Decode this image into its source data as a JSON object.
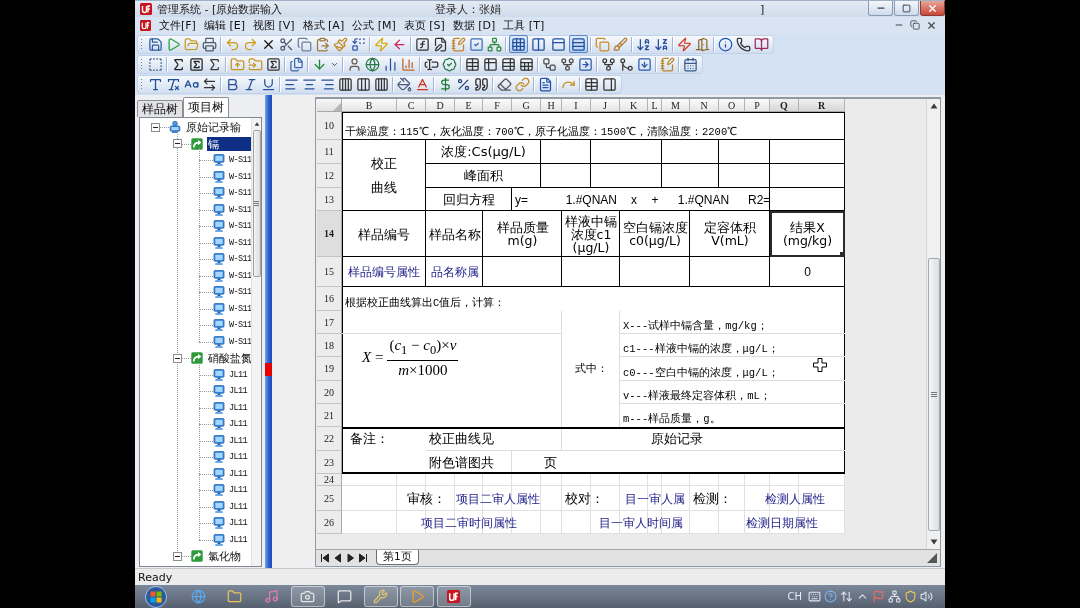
{
  "window": {
    "title": "管理系统 - [原始数据输入",
    "user": "登录人：张娟",
    "title_end": "]"
  },
  "menu": [
    "文件[F]",
    "编辑 [E]",
    "视图 [V]",
    "格式 [A]",
    "公式 [M]",
    "表页 [S]",
    "数据 [D]",
    "工具 [T]"
  ],
  "toolbar": {
    "view_toggles": [
      {
        "pressed": true
      },
      {
        "pressed": false
      },
      {
        "pressed": false
      },
      {
        "pressed": true
      }
    ]
  },
  "side_tabs": [
    {
      "label": "样品树",
      "selected": false
    },
    {
      "label": "项目树",
      "selected": true
    }
  ],
  "tree": [
    {
      "label": "原始记录输",
      "kind": "root",
      "expanded": true,
      "selected": false,
      "children": [
        {
          "label": "镉",
          "kind": "group",
          "expanded": true,
          "selected": true,
          "children": [
            {
              "label": "W-S11",
              "kind": "leaf",
              "selected": false
            },
            {
              "label": "W-S11",
              "kind": "leaf",
              "selected": false
            },
            {
              "label": "W-S11",
              "kind": "leaf",
              "selected": false
            },
            {
              "label": "W-S11",
              "kind": "leaf",
              "selected": false
            },
            {
              "label": "W-S11",
              "kind": "leaf",
              "selected": false
            },
            {
              "label": "W-S11",
              "kind": "leaf",
              "selected": false
            },
            {
              "label": "W-S11",
              "kind": "leaf",
              "selected": false
            },
            {
              "label": "W-S11",
              "kind": "leaf",
              "selected": false
            },
            {
              "label": "W-S11",
              "kind": "leaf",
              "selected": false
            },
            {
              "label": "W-S11",
              "kind": "leaf",
              "selected": false
            },
            {
              "label": "W-S11",
              "kind": "leaf",
              "selected": false
            },
            {
              "label": "W-S11",
              "kind": "leaf",
              "selected": false
            }
          ]
        },
        {
          "label": "硝酸盐氮",
          "kind": "group",
          "expanded": true,
          "selected": false,
          "children": [
            {
              "label": "JL11",
              "kind": "leaf",
              "selected": false
            },
            {
              "label": "JL11",
              "kind": "leaf",
              "selected": false
            },
            {
              "label": "JL11",
              "kind": "leaf",
              "selected": false
            },
            {
              "label": "JL11",
              "kind": "leaf",
              "selected": false
            },
            {
              "label": "JL11",
              "kind": "leaf",
              "selected": false
            },
            {
              "label": "JL11",
              "kind": "leaf",
              "selected": false
            },
            {
              "label": "JL11",
              "kind": "leaf",
              "selected": false
            },
            {
              "label": "JL11",
              "kind": "leaf",
              "selected": false
            },
            {
              "label": "JL11",
              "kind": "leaf",
              "selected": false
            },
            {
              "label": "JL11",
              "kind": "leaf",
              "selected": false
            },
            {
              "label": "JL11",
              "kind": "leaf",
              "selected": false
            }
          ]
        },
        {
          "label": "氯化物",
          "kind": "group",
          "expanded": true,
          "selected": false
        }
      ]
    }
  ],
  "sheet": {
    "column_headers": [
      {
        "label": "B",
        "selected": false
      },
      {
        "label": "C",
        "selected": false
      },
      {
        "label": "D",
        "selected": false
      },
      {
        "label": "E",
        "selected": false
      },
      {
        "label": "F",
        "selected": false
      },
      {
        "label": "G",
        "selected": false
      },
      {
        "label": "H",
        "selected": false
      },
      {
        "label": "I",
        "selected": false
      },
      {
        "label": "J",
        "selected": false
      },
      {
        "label": "K",
        "selected": false
      },
      {
        "label": "L",
        "selected": false
      },
      {
        "label": "M",
        "selected": false
      },
      {
        "label": "N",
        "selected": false
      },
      {
        "label": "O",
        "selected": false
      },
      {
        "label": "P",
        "selected": false
      },
      {
        "label": "Q",
        "selected": true
      },
      {
        "label": "R",
        "selected": true
      }
    ],
    "row_headers": [
      {
        "label": "10",
        "selected": false
      },
      {
        "label": "11",
        "selected": false
      },
      {
        "label": "12",
        "selected": false
      },
      {
        "label": "13",
        "selected": false
      },
      {
        "label": "14",
        "selected": true
      },
      {
        "label": "15",
        "selected": false
      },
      {
        "label": "16",
        "selected": false
      },
      {
        "label": "17",
        "selected": false
      },
      {
        "label": "18",
        "selected": false
      },
      {
        "label": "19",
        "selected": false
      },
      {
        "label": "20",
        "selected": false
      },
      {
        "label": "21",
        "selected": false
      },
      {
        "label": "22",
        "selected": false
      },
      {
        "label": "23",
        "selected": false
      },
      {
        "label": "24",
        "selected": false
      },
      {
        "label": "25",
        "selected": false
      },
      {
        "label": "26",
        "selected": false
      }
    ],
    "cells": [
      {
        "text": "干燥温度：115℃，灰化温度：700℃，原子化温度：1500℃，清除温度：2200℃",
        "kind": "note",
        "selected": false
      },
      {
        "text": "校正曲线",
        "kind": "label",
        "selected": false
      },
      {
        "text": "浓度:Cs(μg/L)",
        "kind": "label",
        "selected": false
      },
      {
        "text": "峰面积",
        "kind": "label",
        "selected": false
      },
      {
        "text": "回归方程",
        "kind": "label",
        "selected": false
      },
      {
        "text": "y=",
        "kind": "value",
        "selected": false
      },
      {
        "text": "1.#QNAN",
        "kind": "value",
        "selected": false
      },
      {
        "text": "x",
        "kind": "value",
        "selected": false
      },
      {
        "text": "+",
        "kind": "value",
        "selected": false
      },
      {
        "text": "1.#QNAN",
        "kind": "value",
        "selected": false
      },
      {
        "text": "R2=",
        "kind": "value",
        "selected": false
      },
      {
        "text": "样品编号",
        "kind": "header",
        "selected": false
      },
      {
        "text": "样品名称",
        "kind": "header",
        "selected": false
      },
      {
        "text": "样品质量\nm(g)",
        "kind": "header",
        "selected": false
      },
      {
        "text": "样液中镉浓度c1(μg/L)",
        "kind": "header",
        "selected": false
      },
      {
        "text": "空白镉浓度\nc0(μg/L)",
        "kind": "header",
        "selected": false
      },
      {
        "text": "定容体积\nV(mL)",
        "kind": "header",
        "selected": false
      },
      {
        "text": "结果X\n(mg/kg)",
        "kind": "header",
        "selected": true
      },
      {
        "text": "样品编号属性",
        "kind": "attribute",
        "selected": false
      },
      {
        "text": "品名称属",
        "kind": "attribute",
        "selected": false
      },
      {
        "text": "0",
        "kind": "value",
        "selected": false
      },
      {
        "text": "根据校正曲线算出C值后，计算：",
        "kind": "note",
        "selected": false
      },
      {
        "text": "式中：",
        "kind": "note",
        "selected": false
      },
      {
        "text": "X---试样中镉含量，mg/kg；",
        "kind": "note",
        "selected": false
      },
      {
        "text": "c1---样液中镉的浓度，μg/L；",
        "kind": "note",
        "selected": false
      },
      {
        "text": "c0---空白中镉的浓度，μg/L；",
        "kind": "note",
        "selected": false
      },
      {
        "text": "v---样液最终定容体积，mL；",
        "kind": "note",
        "selected": false
      },
      {
        "text": "m---样品质量，g。",
        "kind": "note",
        "selected": false
      },
      {
        "text": "备注：",
        "kind": "label",
        "selected": false
      },
      {
        "text": "校正曲线见",
        "kind": "label",
        "selected": false
      },
      {
        "text": "原始记录",
        "kind": "label",
        "selected": false
      },
      {
        "text": "附色谱图共",
        "kind": "label",
        "selected": false
      },
      {
        "text": "页",
        "kind": "label",
        "selected": false
      },
      {
        "text": "审核：",
        "kind": "label",
        "selected": false
      },
      {
        "text": "项目二审人属性",
        "kind": "attribute",
        "selected": false
      },
      {
        "text": "校对：",
        "kind": "label",
        "selected": false
      },
      {
        "text": "目一审人属",
        "kind": "attribute",
        "selected": false
      },
      {
        "text": "检测：",
        "kind": "label",
        "selected": false
      },
      {
        "text": "检测人属性",
        "kind": "attribute",
        "selected": false
      },
      {
        "text": "项目二审时间属性",
        "kind": "attribute",
        "selected": false
      },
      {
        "text": "目一审人时间属",
        "kind": "attribute",
        "selected": false
      },
      {
        "text": "检测日期属性",
        "kind": "attribute",
        "selected": false
      }
    ],
    "formula": {
      "lhs": "*X* =",
      "numerator": "(*c*$_{1}$ − *c*$_{0}$)×*v*",
      "denominator": "*m*×1000"
    },
    "tabs": [
      {
        "label": "第1页",
        "selected": true
      }
    ]
  },
  "status_bar": "Ready",
  "taskbar": {
    "apps": [
      {
        "running": false
      },
      {
        "running": false
      },
      {
        "running": false
      },
      {
        "running": true
      },
      {
        "running": false
      },
      {
        "running": true
      },
      {
        "running": true
      },
      {
        "running": true
      }
    ],
    "language": "CH"
  }
}
